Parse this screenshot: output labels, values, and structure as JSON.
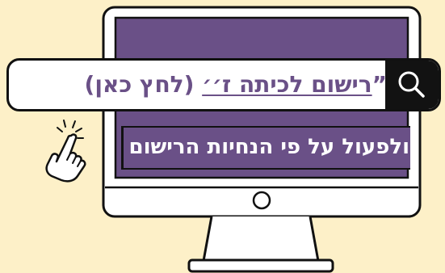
{
  "search": {
    "text_before": "”",
    "text_link": "רישום לכיתה ז׳׳",
    "text_after": " (לחץ כאן)"
  },
  "instruction": {
    "text": "ולפעול על פי הנחיות הרישום"
  },
  "icons": {
    "search": "search-icon",
    "hand": "pointing-hand-icon",
    "monitor": "monitor-icon"
  },
  "colors": {
    "background": "#fdf0c8",
    "screen": "#6a5087",
    "accent_text": "#6a5087",
    "outline": "#111111",
    "search_button": "#121212"
  }
}
